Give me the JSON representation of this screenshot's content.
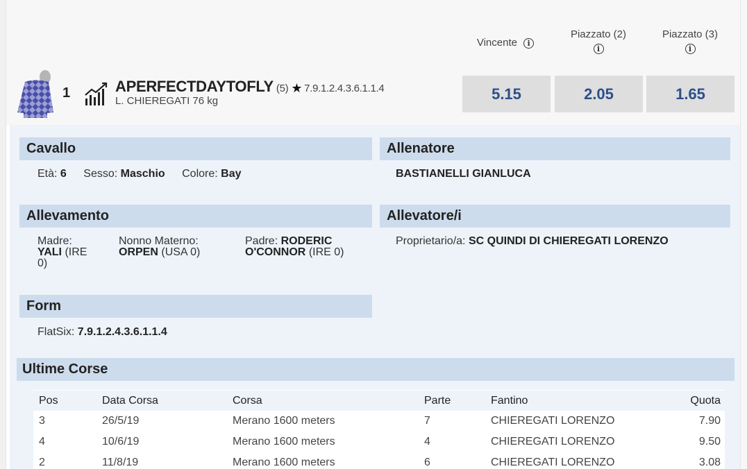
{
  "odds_headers": [
    {
      "label": "Vincente"
    },
    {
      "label": "Piazzato (2)"
    },
    {
      "label": "Piazzato (3)"
    }
  ],
  "runner": {
    "number": "1",
    "name": "APERFECTDAYTOFLY",
    "draw": "(5)",
    "form": "7.9.1.2.4.3.6.1.1.4",
    "jockey_weight": "L. CHIEREGATI 76 kg",
    "odds": [
      "5.15",
      "2.05",
      "1.65"
    ]
  },
  "colors": {
    "accent": "#2b4f8a",
    "section_header": "#cddcec",
    "detail_bg": "#edf3f9",
    "jersey": "#5b5fb0"
  },
  "icons": {
    "info": "info-circle-icon",
    "star": "star-icon",
    "trend": "trend-chart-icon",
    "jersey": "jockey-silks-icon"
  },
  "cavallo": {
    "title": "Cavallo",
    "eta_label": "Età:",
    "eta_value": "6",
    "sesso_label": "Sesso:",
    "sesso_value": "Maschio",
    "colore_label": "Colore:",
    "colore_value": "Bay"
  },
  "allenatore": {
    "title": "Allenatore",
    "name": "BASTIANELLI GIANLUCA"
  },
  "allevamento": {
    "title": "Allevamento",
    "madre_label": "Madre:",
    "madre_value": "YALI",
    "madre_origin_1": "(IRE",
    "madre_origin_2": "0)",
    "nonno_label": "Nonno Materno:",
    "nonno_value": "ORPEN",
    "nonno_origin": "(USA 0)",
    "padre_label": "Padre:",
    "padre_value_1": "RODERIC",
    "padre_value_2": "O'CONNOR",
    "padre_origin": "(IRE 0)"
  },
  "allevatore": {
    "title": "Allevatore/i",
    "label": "Proprietario/a:",
    "value": "SC QUINDI DI CHIEREGATI LORENZO"
  },
  "form_section": {
    "title": "Form",
    "label": "FlatSix:",
    "value": "7.9.1.2.4.3.6.1.1.4"
  },
  "ultime_corse": {
    "title": "Ultime Corse",
    "headers": {
      "pos": "Pos",
      "data": "Data Corsa",
      "corsa": "Corsa",
      "parte": "Parte",
      "fantino": "Fantino",
      "quota": "Quota"
    },
    "rows": [
      {
        "pos": "3",
        "data": "26/5/19",
        "corsa": "Merano 1600 meters",
        "parte": "7",
        "fantino": "CHIEREGATI LORENZO",
        "quota": "7.90"
      },
      {
        "pos": "4",
        "data": "10/6/19",
        "corsa": "Merano 1600 meters",
        "parte": "4",
        "fantino": "CHIEREGATI LORENZO",
        "quota": "9.50"
      },
      {
        "pos": "2",
        "data": "11/8/19",
        "corsa": "Merano 1600 meters",
        "parte": "6",
        "fantino": "CHIEREGATI LORENZO",
        "quota": "3.08"
      }
    ]
  }
}
